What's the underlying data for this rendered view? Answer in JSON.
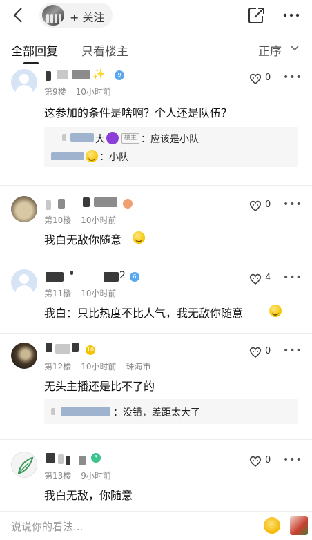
{
  "header": {
    "back_icon": "back-arrow-icon",
    "follow_label": "+ 关注",
    "share_icon": "share-icon",
    "more_icon": "more-icon"
  },
  "tabs": {
    "all_label": "全部回复",
    "owner_label": "只看楼主",
    "sort_label": "正序"
  },
  "floors": [
    {
      "floor": "第9楼",
      "time": "10小时前",
      "location": "",
      "text": "这参加的条件是啥啊？个人还是队伍？",
      "likes": "0",
      "level_badge": "9",
      "replies": [
        {
          "owner_tag": "楼主",
          "suffix_char": "大",
          "text": "：应该是小队"
        },
        {
          "suffix_char": "",
          "text": "：小队"
        }
      ]
    },
    {
      "floor": "第10楼",
      "time": "10小时前",
      "location": "",
      "text": "我白无敌你随意",
      "likes": "0"
    },
    {
      "floor": "第11楼",
      "time": "10小时前",
      "location": "",
      "text": "我白：只比热度不比人气，我无敌你随意",
      "likes": "4",
      "name_digit": "2",
      "level_badge": "6"
    },
    {
      "floor": "第12楼",
      "time": "10小时前",
      "location": "珠海市",
      "text": "无头主播还是比不了的",
      "likes": "0",
      "level_badge": "10",
      "replies": [
        {
          "text": "：没错，差距太大了"
        }
      ]
    },
    {
      "floor": "第13楼",
      "time": "9小时前",
      "location": "",
      "text": "我白无敌，你随意",
      "likes": "0",
      "level_badge": "3"
    }
  ],
  "more_dots": "•••",
  "bottom": {
    "placeholder": "说说你的看法..."
  },
  "colors": {
    "accent_blue": "#5aa9f0",
    "level_gold": "#f5c400",
    "level_green": "#3cc48c"
  }
}
